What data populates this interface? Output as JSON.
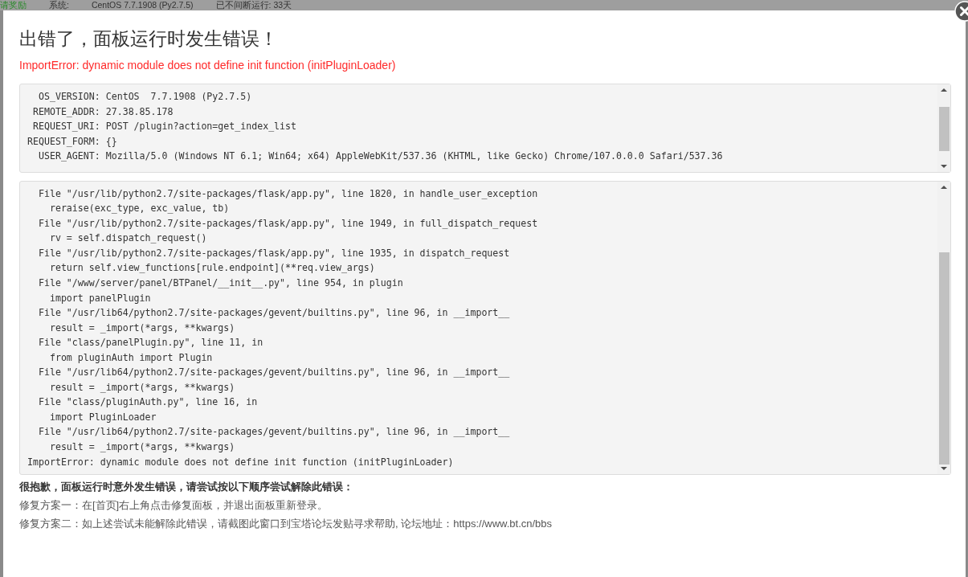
{
  "background_bar": {
    "items": [
      "请奖励",
      "系统:",
      "CentOS 7.7.1908 (Py2.7.5)",
      "已不间断运行: 33天"
    ]
  },
  "dialog": {
    "title": "出错了，面板运行时发生错误！",
    "error": "ImportError: dynamic module does not define init function (initPluginLoader)",
    "request_info": [
      "  OS_VERSION: CentOS  7.7.1908 (Py2.7.5)",
      " REMOTE_ADDR: 27.38.85.178",
      " REQUEST_URI: POST /plugin?action=get_index_list",
      "REQUEST_FORM: {}",
      "  USER_AGENT: Mozilla/5.0 (Windows NT 6.1; Win64; x64) AppleWebKit/537.36 (KHTML, like Gecko) Chrome/107.0.0.0 Safari/537.36"
    ],
    "traceback": [
      "  File \"/usr/lib/python2.7/site-packages/flask/app.py\", line 1820, in handle_user_exception",
      "    reraise(exc_type, exc_value, tb)",
      "  File \"/usr/lib/python2.7/site-packages/flask/app.py\", line 1949, in full_dispatch_request",
      "    rv = self.dispatch_request()",
      "  File \"/usr/lib/python2.7/site-packages/flask/app.py\", line 1935, in dispatch_request",
      "    return self.view_functions[rule.endpoint](**req.view_args)",
      "  File \"/www/server/panel/BTPanel/__init__.py\", line 954, in plugin",
      "    import panelPlugin",
      "  File \"/usr/lib64/python2.7/site-packages/gevent/builtins.py\", line 96, in __import__",
      "    result = _import(*args, **kwargs)",
      "  File \"class/panelPlugin.py\", line 11, in",
      "    from pluginAuth import Plugin",
      "  File \"/usr/lib64/python2.7/site-packages/gevent/builtins.py\", line 96, in __import__",
      "    result = _import(*args, **kwargs)",
      "  File \"class/pluginAuth.py\", line 16, in",
      "    import PluginLoader",
      "  File \"/usr/lib64/python2.7/site-packages/gevent/builtins.py\", line 96, in __import__",
      "    result = _import(*args, **kwargs)",
      "ImportError: dynamic module does not define init function (initPluginLoader)"
    ],
    "help_heading": "很抱歉，面板运行时意外发生错误，请尝试按以下顺序尝试解除此错误：",
    "help_lines": [
      "修复方案一：在[首页]右上角点击修复面板，并退出面板重新登录。",
      "修复方案二：如上述尝试未能解除此错误，请截图此窗口到宝塔论坛发贴寻求帮助, 论坛地址：https://www.bt.cn/bbs"
    ]
  }
}
